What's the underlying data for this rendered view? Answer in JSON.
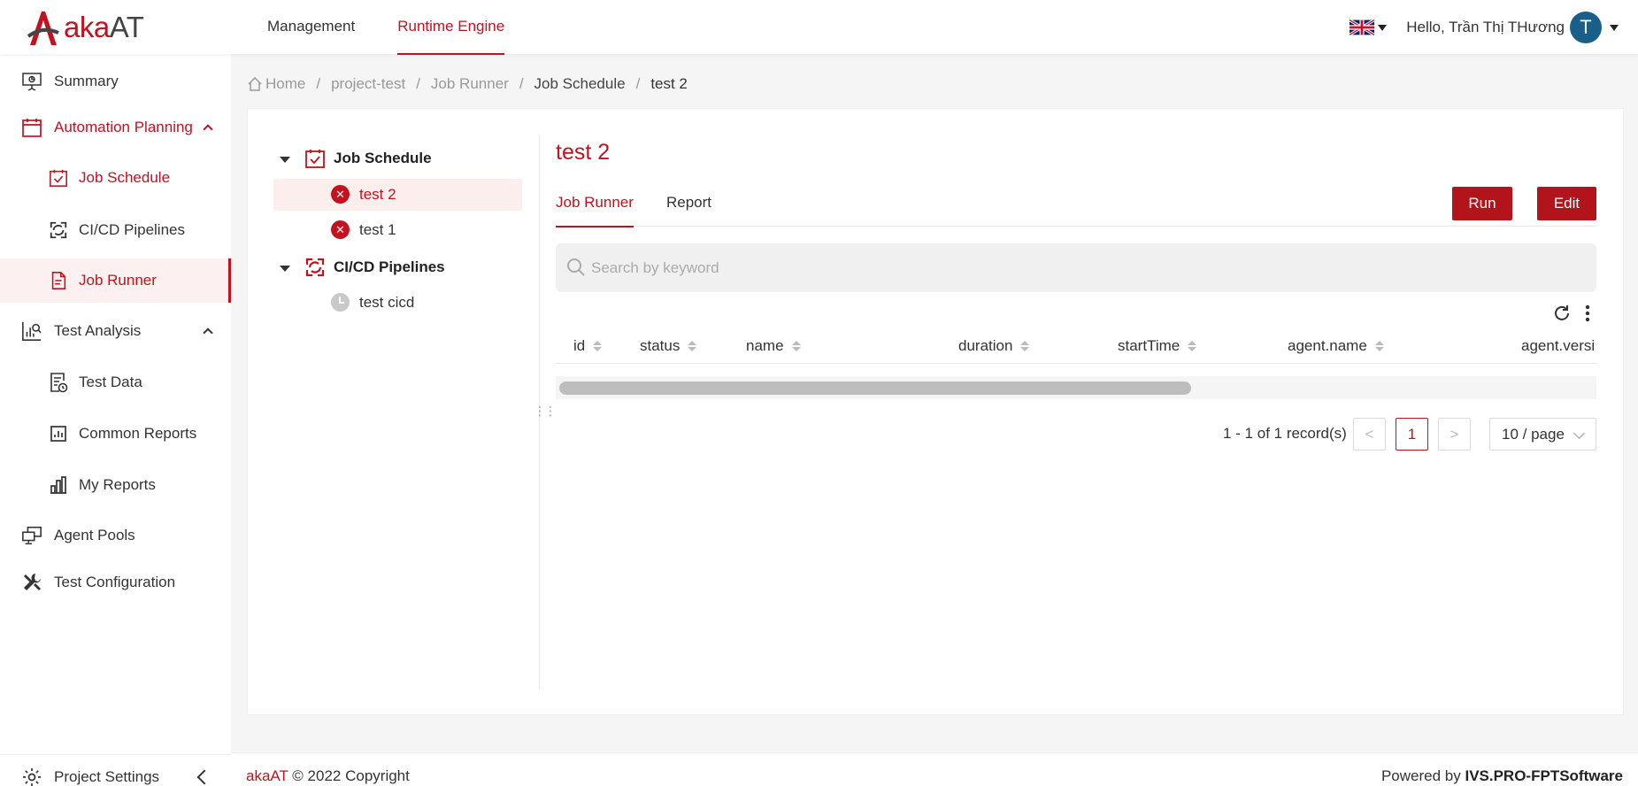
{
  "header": {
    "logo_aka": "aka",
    "logo_at": "AT",
    "nav": [
      {
        "label": "Management",
        "active": false
      },
      {
        "label": "Runtime Engine",
        "active": true
      }
    ],
    "language_flag": "uk-flag-icon",
    "greeting": "Hello, Trần Thị THương",
    "avatar_initial": "T"
  },
  "sidebar": {
    "items": [
      {
        "label": "Summary",
        "icon": "presentation-icon"
      },
      {
        "label": "Automation Planning",
        "icon": "calendar-icon",
        "expanded": true
      },
      {
        "label": "Job Schedule",
        "icon": "calendar-check-icon"
      },
      {
        "label": "CI/CD Pipelines",
        "icon": "pipeline-icon"
      },
      {
        "label": "Job Runner",
        "icon": "document-icon",
        "selected": true
      },
      {
        "label": "Test Analysis",
        "icon": "analytics-icon",
        "expanded": true
      },
      {
        "label": "Test Data",
        "icon": "test-data-icon"
      },
      {
        "label": "Common Reports",
        "icon": "bar-chart-icon"
      },
      {
        "label": "My Reports",
        "icon": "my-reports-icon"
      },
      {
        "label": "Agent Pools",
        "icon": "monitors-icon"
      },
      {
        "label": "Test Configuration",
        "icon": "tools-icon"
      }
    ],
    "project_settings": "Project Settings"
  },
  "breadcrumb": [
    "Home",
    "project-test",
    "Job Runner",
    "Job Schedule",
    "test 2"
  ],
  "tree": {
    "groups": [
      {
        "label": "Job Schedule",
        "children": [
          {
            "label": "test 2",
            "status": "failed",
            "selected": true
          },
          {
            "label": "test 1",
            "status": "failed",
            "selected": false
          }
        ]
      },
      {
        "label": "CI/CD Pipelines",
        "children": [
          {
            "label": "test cicd",
            "status": "pending",
            "selected": false
          }
        ]
      }
    ]
  },
  "detail": {
    "title": "test 2",
    "tabs": [
      {
        "label": "Job Runner",
        "active": true
      },
      {
        "label": "Report",
        "active": false
      }
    ],
    "run_label": "Run",
    "edit_label": "Edit",
    "search_placeholder": "Search by keyword",
    "columns": [
      "id",
      "status",
      "name",
      "duration",
      "startTime",
      "agent.name",
      "agent.versi"
    ],
    "pagination": {
      "total_text": "1 - 1 of 1 record(s)",
      "prev": "<",
      "current": "1",
      "next": ">",
      "page_size": "10 / page"
    }
  },
  "footer": {
    "brand": "akaAT",
    "copyright": " © 2022 Copyright",
    "powered_prefix": "Powered by ",
    "powered_by": "IVS.PRO-FPTSoftware"
  },
  "colors": {
    "accent": "#c1121f",
    "button": "#b3141c",
    "selected_bg": "#fdf0f0"
  }
}
